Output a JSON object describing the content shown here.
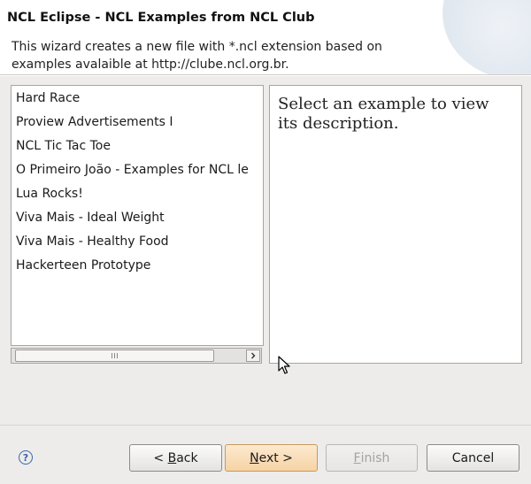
{
  "wizard": {
    "title": "NCL Eclipse - NCL Examples from NCL Club",
    "description": "This wizard creates a new file with *.ncl extension based on examples avalaible at http://clube.ncl.org.br."
  },
  "examples": [
    "Hard Race",
    "Proview Advertisements I",
    "NCL Tic Tac Toe",
    "O Primeiro João - Examples for NCL le",
    "Lua Rocks!",
    "Viva Mais - Ideal Weight",
    "Viva Mais - Healthy Food",
    "Hackerteen Prototype"
  ],
  "description_panel": {
    "text": "Select an example to view its description."
  },
  "buttons": {
    "back": {
      "mnemonic": "B",
      "rest": "ack",
      "prefix": "< "
    },
    "next": {
      "mnemonic": "N",
      "rest": "ext >"
    },
    "finish": {
      "mnemonic": "F",
      "rest": "inish"
    },
    "cancel": "Cancel"
  },
  "icons": {
    "help": "help-icon",
    "scroll_left": "scroll-left-icon",
    "scroll_right": "scroll-right-icon",
    "cursor": "mouse-pointer-icon"
  },
  "colors": {
    "header_bg": "#ffffff",
    "dialog_bg": "#edeceb",
    "next_button": "#f6d3a4",
    "help_icon": "#3b66a8"
  }
}
